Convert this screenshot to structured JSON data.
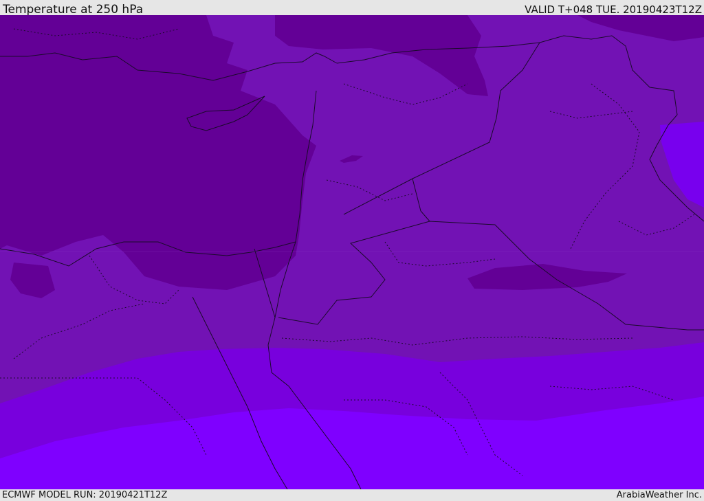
{
  "header": {
    "title": "Temperature at 250 hPa",
    "valid_time": "VALID T+048 TUE. 20190423T12Z"
  },
  "footer": {
    "model_run": "ECMWF MODEL RUN: 20190421T12Z",
    "credit": "ArabiaWeather Inc."
  },
  "map": {
    "region": "Eastern Mediterranean / Middle East",
    "colors": {
      "coldest": "#630096",
      "cold": "#7212b4",
      "mid": "#7a00d8",
      "warm": "#7800ee",
      "warmest": "#7f00ff",
      "coastline": "#1a0a2a"
    }
  }
}
